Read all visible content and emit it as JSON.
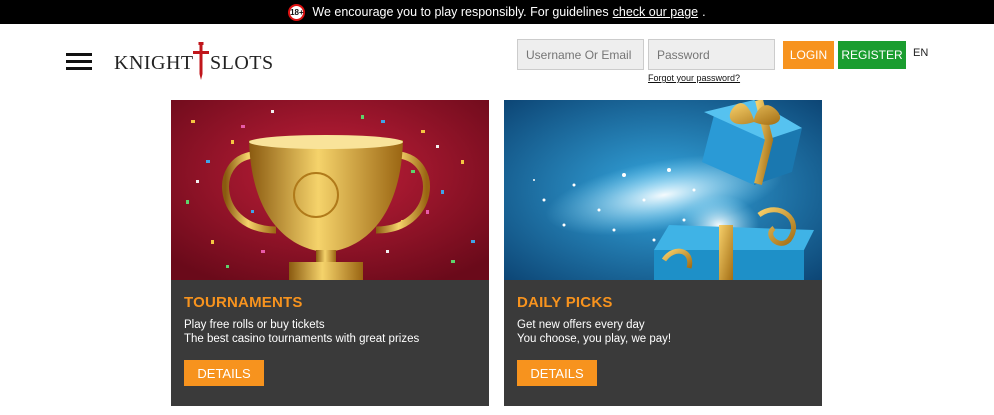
{
  "topbar": {
    "age_badge": "18+",
    "message": "We encourage you to play responsibly. For guidelines",
    "link": "check our page",
    "suffix": "."
  },
  "header": {
    "logo_left": "KNIGHT",
    "logo_right": "SLOTS",
    "username_placeholder": "Username Or Email",
    "password_placeholder": "Password",
    "forgot_password": "Forgot your password?",
    "login_label": "LOGIN",
    "register_label": "REGISTER",
    "language": "EN"
  },
  "colors": {
    "accent": "#f7931e",
    "register": "#1a9d2f",
    "card_bg": "#3a3a3a"
  },
  "cards": [
    {
      "title": "TOURNAMENTS",
      "line1": "Play free rolls or buy tickets",
      "line2": "The best casino tournaments with great prizes",
      "button": "DETAILS",
      "image": "trophy-confetti-image"
    },
    {
      "title": "DAILY PICKS",
      "line1": "Get new offers every day",
      "line2": "You choose, you play, we pay!",
      "button": "DETAILS",
      "image": "gift-box-sparkle-image"
    }
  ]
}
